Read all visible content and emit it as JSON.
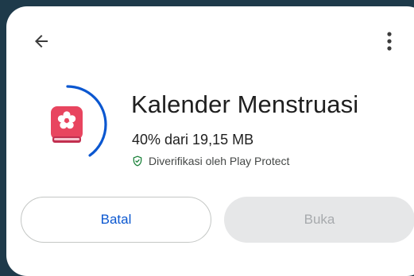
{
  "header": {
    "back_icon": "arrow-back-icon",
    "more_icon": "more-vert-icon"
  },
  "app": {
    "name": "Kalender Menstruasi",
    "icon": "flower-book-icon",
    "icon_color": "#e8455f",
    "download_progress_text": "40% dari 19,15 MB",
    "download_progress": 0.4,
    "verified_text": "Diverifikasi oleh Play Protect",
    "verified_icon": "shield-check-icon",
    "verified_icon_color": "#188038"
  },
  "actions": {
    "cancel_label": "Batal",
    "open_label": "Buka"
  },
  "colors": {
    "accent": "#0b57d0",
    "progress_ring": "#0b57d0",
    "disabled_text": "#a7aaad",
    "disabled_bg": "#e6e7e8"
  }
}
